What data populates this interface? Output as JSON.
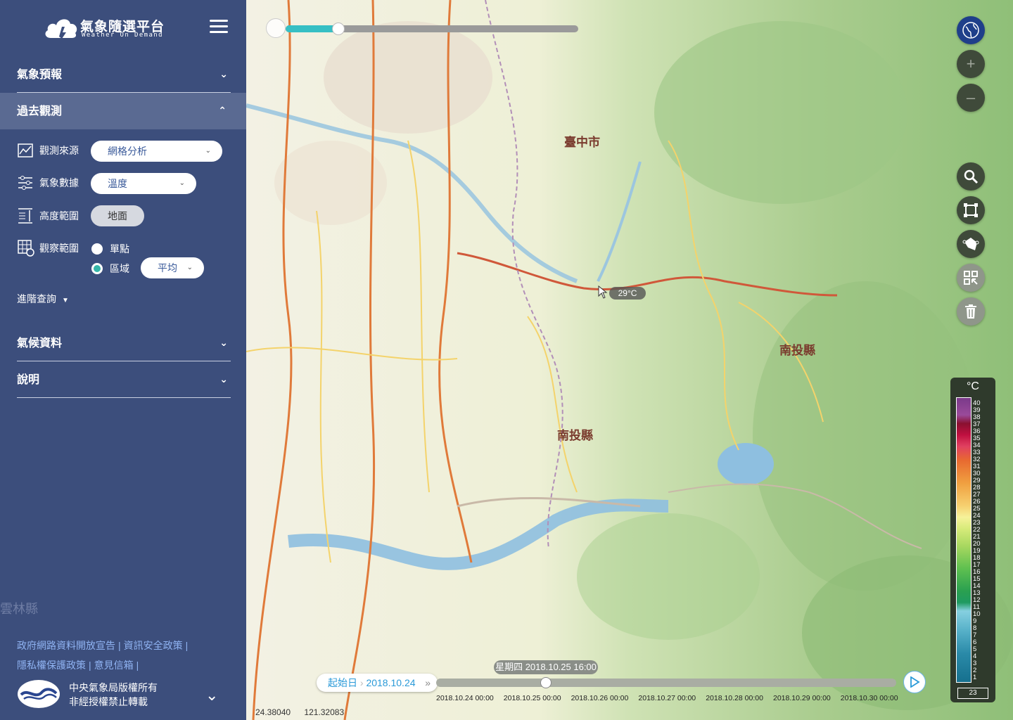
{
  "brand": {
    "name": "氣象隨選平台",
    "subtitle": "Weather On Demand"
  },
  "menu": {
    "forecast": "氣象預報",
    "past": "過去觀測",
    "climate": "氣候資料",
    "help": "說明"
  },
  "past_obs": {
    "source_label": "觀測來源",
    "source_value": "網格分析",
    "data_label": "氣象數據",
    "data_value": "溫度",
    "height_label": "高度範圍",
    "height_value": "地面",
    "scope_label": "觀察範圍",
    "scope_point": "單點",
    "scope_area": "區域",
    "scope_agg": "平均",
    "scope_selected": "區域",
    "advanced": "進階查詢"
  },
  "side_map_text": "雲林縣",
  "links": {
    "open_data": "政府網路資料開放宣告",
    "security": "資訊安全政策",
    "privacy": "隱私權保護政策",
    "feedback": "意見信箱"
  },
  "copyright": {
    "line1": "中央氣象局版權所有",
    "line2": "非經授權禁止轉載"
  },
  "map": {
    "labels": {
      "taichung": "臺中市",
      "nantou_county_e": "南投縣",
      "nantou_county": "南投縣"
    },
    "hover_temp": "29°C",
    "layer_opacity": 0.18
  },
  "coords": {
    "lat": "24.38040",
    "lon": "121.32083"
  },
  "timeline": {
    "start_label": "起始日",
    "start_date": "2018.10.24",
    "current": "星期四 2018.10.25 16:00",
    "position": 0.238,
    "ticks": [
      "2018.10.24 00:00",
      "2018.10.25 00:00",
      "2018.10.26 00:00",
      "2018.10.27 00:00",
      "2018.10.28 00:00",
      "2018.10.29 00:00",
      "2018.10.30 00:00"
    ]
  },
  "legend": {
    "unit": "°C",
    "labels": [
      "40",
      "39",
      "38",
      "37",
      "36",
      "35",
      "34",
      "33",
      "32",
      "31",
      "30",
      "29",
      "28",
      "27",
      "26",
      "25",
      "24",
      "23",
      "22",
      "21",
      "20",
      "19",
      "18",
      "17",
      "16",
      "15",
      "14",
      "13",
      "12",
      "11",
      "10",
      "9",
      "8",
      "7",
      "6",
      "5",
      "4",
      "3",
      "2",
      "1"
    ],
    "current_value": "23"
  },
  "icons": {
    "menu": "hamburger-icon",
    "globe": "globe-icon",
    "zoom_in": "plus-icon",
    "zoom_out": "minus-icon",
    "search": "search-icon",
    "extent": "frame-icon",
    "polygon": "polygon-draw-icon",
    "select": "select-area-icon",
    "trash": "trash-icon",
    "play": "play-icon"
  },
  "colors": {
    "sidebar": "#3c4e7c",
    "accent": "#35b6a9",
    "link": "#8fb3f2"
  }
}
